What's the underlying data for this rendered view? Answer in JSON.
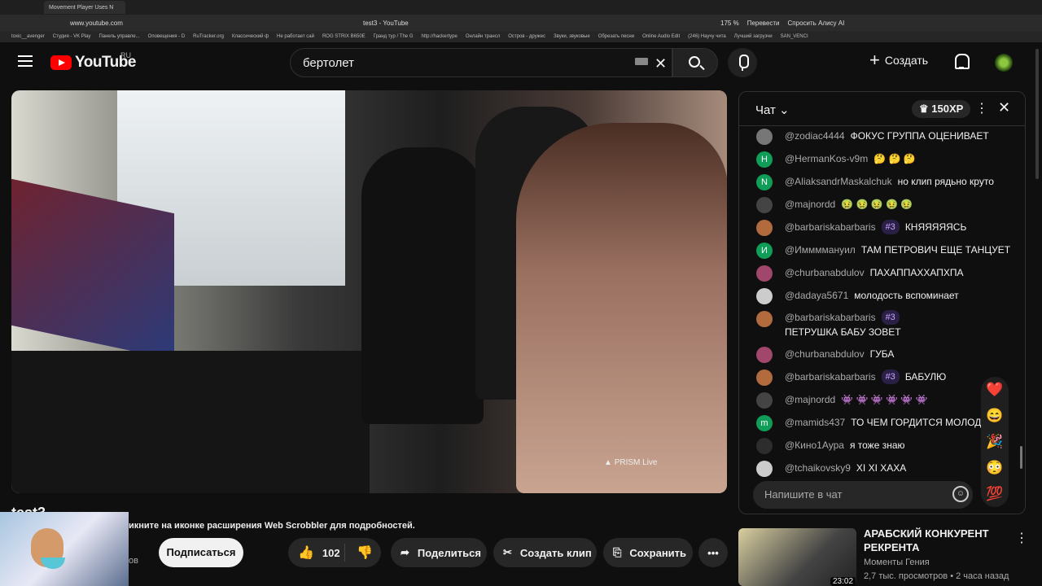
{
  "browser": {
    "tab_title": "Movement Player Uses N",
    "url": "www.youtube.com",
    "page_title": "test3 - YouTube",
    "zoom": "175 %",
    "translate": "Перевести",
    "ask_alice": "Спросить Алису AI",
    "bookmarks": [
      "toxic__avenger",
      "Студия - VK Play",
      "Панель управле...",
      "Оповещения - D",
      "RuTracker.org",
      "Классический ф",
      "Не работает сай",
      "ROG STRIX B650E",
      "Гранд тур / The G",
      "http://hackertype",
      "Онлайн трансл",
      "Остров - дружес",
      "Звуки, звуковые",
      "Обрезать песни",
      "Online Audio Edit",
      "(246) Научу чита",
      "Лучший загрузчи",
      "SAN_VENCI"
    ]
  },
  "header": {
    "logo_text": "YouTube",
    "logo_region": "RU",
    "search_value": "бертолет",
    "create_label": "Создать"
  },
  "video": {
    "overlay": "PRISM Live",
    "title": "test3",
    "scrobbler_note": "икните на иконке расширения Web Scrobbler для подробностей.",
    "subs_fragment": "ов",
    "subscribe_label": "Подписаться",
    "likes": "102",
    "share_label": "Поделиться",
    "clip_label": "Создать клип",
    "save_label": "Сохранить"
  },
  "chat": {
    "title": "Чат",
    "xp": "150XP",
    "input_placeholder": "Напишите в чат",
    "messages": [
      {
        "user": "@zodiac4444",
        "badge": "",
        "text": "ФОКУС ГРУППА ОЦЕНИВАЕТ",
        "avatar": "",
        "color": "#777777"
      },
      {
        "user": "@HermanKos-v9m",
        "badge": "",
        "text": "🤔 🤔 🤔",
        "avatar": "H",
        "color": "#0f9d58"
      },
      {
        "user": "@AliaksandrMaskalchuk",
        "badge": "",
        "text": "но клип рядьно круто",
        "avatar": "N",
        "color": "#0f9d58"
      },
      {
        "user": "@majnordd",
        "badge": "",
        "text": "🤢 🤢 🤢 🤢 🤢",
        "avatar": "",
        "color": "#444444"
      },
      {
        "user": "@barbariskabarbaris",
        "badge": "#3",
        "text": "КНЯЯЯЯЯСЬ",
        "avatar": "",
        "color": "#b36b3d"
      },
      {
        "user": "@Иммммануил",
        "badge": "",
        "text": "ТАМ ПЕТРОВИЧ ЕЩЕ ТАНЦУЕТ",
        "avatar": "И",
        "color": "#0f9d58"
      },
      {
        "user": "@churbanabdulov",
        "badge": "",
        "text": "ПАХАППАХХАПХПА",
        "avatar": "",
        "color": "#a1476b"
      },
      {
        "user": "@dadaya5671",
        "badge": "",
        "text": "молодость вспоминает",
        "avatar": "",
        "color": "#cccccc"
      },
      {
        "user": "@barbariskabarbaris",
        "badge": "#3",
        "text": "ПЕТРУШКА БАБУ ЗОВЕТ",
        "avatar": "",
        "color": "#b36b3d"
      },
      {
        "user": "@churbanabdulov",
        "badge": "",
        "text": "ГУБА",
        "avatar": "",
        "color": "#a1476b"
      },
      {
        "user": "@barbariskabarbaris",
        "badge": "#3",
        "text": "БАБУЛЮ",
        "avatar": "",
        "color": "#b36b3d"
      },
      {
        "user": "@majnordd",
        "badge": "",
        "text": "👾 👾 👾 👾 👾 👾",
        "avatar": "",
        "color": "#444444"
      },
      {
        "user": "@mamids437",
        "badge": "",
        "text": "ТО ЧЕМ ГОРДИТСЯ МОЛОДЕЖ",
        "avatar": "m",
        "color": "#0f9d58"
      },
      {
        "user": "@Кино1Аура",
        "badge": "",
        "text": "я тоже знаю",
        "avatar": "",
        "color": "#2d2d2d"
      },
      {
        "user": "@tchaikovsky9",
        "badge": "",
        "text": "XI XI ХАХА",
        "avatar": "",
        "color": "#cccccc"
      }
    ],
    "reactions": [
      "❤️",
      "😄",
      "🎉",
      "😳",
      "💯"
    ]
  },
  "recommendation": {
    "title": "АРАБСКИЙ КОНКУРЕНТ РЕКРЕНТА",
    "channel": "Моменты Гения",
    "meta": "2,7 тыс. просмотров • 2 часа назад",
    "duration": "23:02"
  }
}
